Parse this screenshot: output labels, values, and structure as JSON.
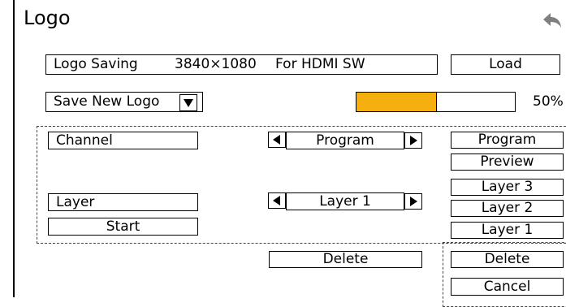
{
  "window": {
    "title": "Logo",
    "back_icon": "back-arrow-icon"
  },
  "colors": {
    "progress_fill": "#f5b00f",
    "dashed_border": "#444444"
  },
  "logo_info": {
    "name": "Logo Saving",
    "resolution": "3840×1080",
    "target": "For HDMI SW"
  },
  "load_label": "Load",
  "save_select": {
    "selected": "Save New Logo",
    "icon": "dropdown-arrow-icon"
  },
  "progress": {
    "value": 0.5,
    "label": "50%"
  },
  "channel": {
    "label": "Channel",
    "value": "Program"
  },
  "layer": {
    "label": "Layer",
    "value": "Layer 1"
  },
  "start_label": "Start",
  "delete_label": "Delete",
  "right_list": {
    "items": [
      "Program",
      "Preview",
      "Layer 3",
      "Layer 2",
      "Layer 1"
    ],
    "delete_label": "Delete",
    "cancel_label": "Cancel"
  }
}
